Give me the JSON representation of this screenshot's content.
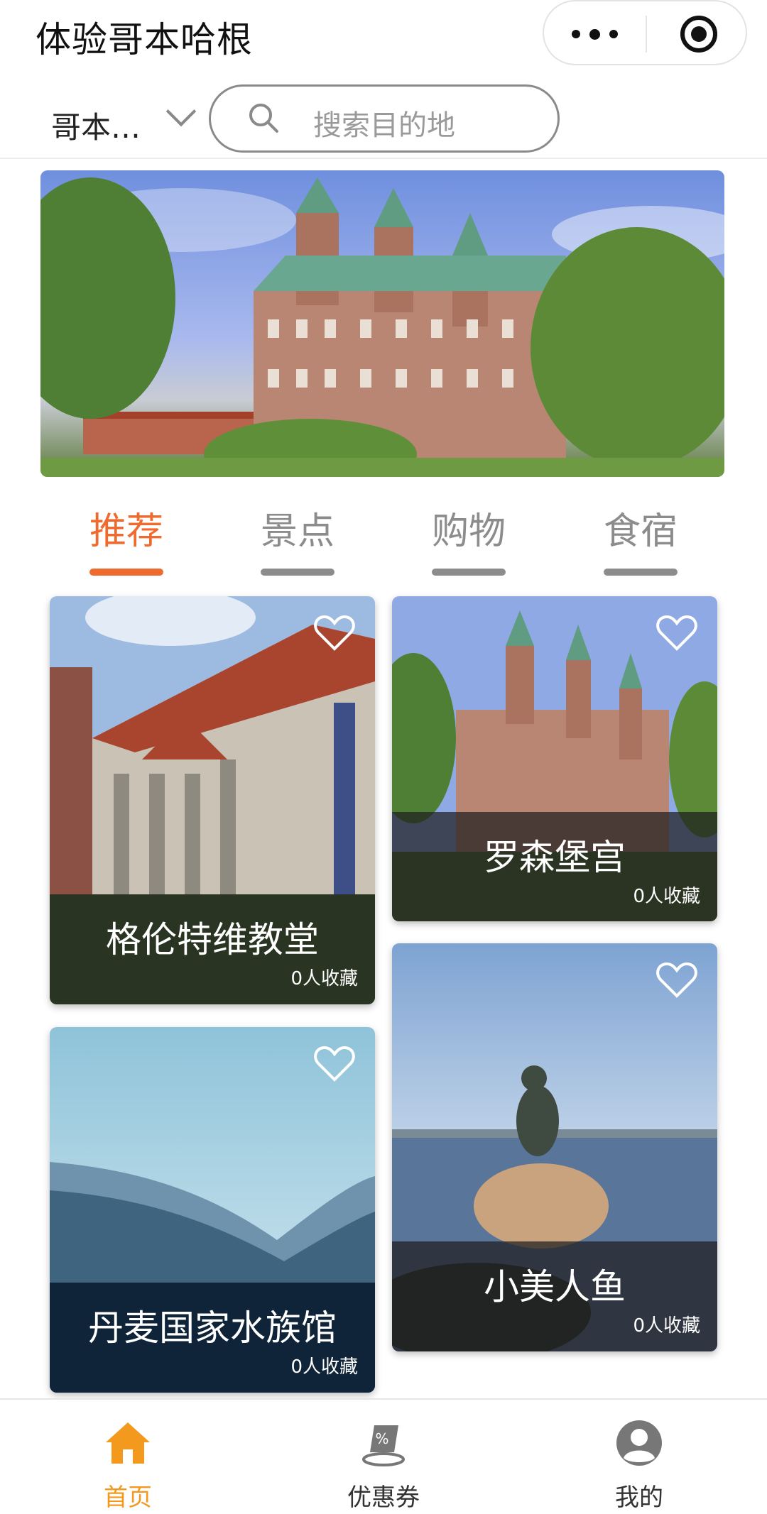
{
  "header": {
    "title": "体验哥本哈根"
  },
  "search": {
    "city": "哥本…",
    "placeholder": "搜索目的地"
  },
  "tabs": [
    {
      "label": "推荐",
      "active": true
    },
    {
      "label": "景点",
      "active": false
    },
    {
      "label": "购物",
      "active": false
    },
    {
      "label": "食宿",
      "active": false
    }
  ],
  "cards": [
    {
      "name": "格伦特维教堂",
      "favorites": "0人收藏"
    },
    {
      "name": "罗森堡宫",
      "favorites": "0人收藏"
    },
    {
      "name": "丹麦国家水族馆",
      "favorites": "0人收藏"
    },
    {
      "name": "小美人鱼",
      "favorites": "0人收藏"
    }
  ],
  "tabbar": [
    {
      "label": "首页",
      "icon": "home-icon",
      "active": true
    },
    {
      "label": "优惠券",
      "icon": "coupon-icon",
      "active": false
    },
    {
      "label": "我的",
      "icon": "user-icon",
      "active": false
    }
  ],
  "colors": {
    "accent": "#ef6a2e",
    "tabbar_active": "#f39a1e",
    "inactive": "#8c8c8c"
  }
}
